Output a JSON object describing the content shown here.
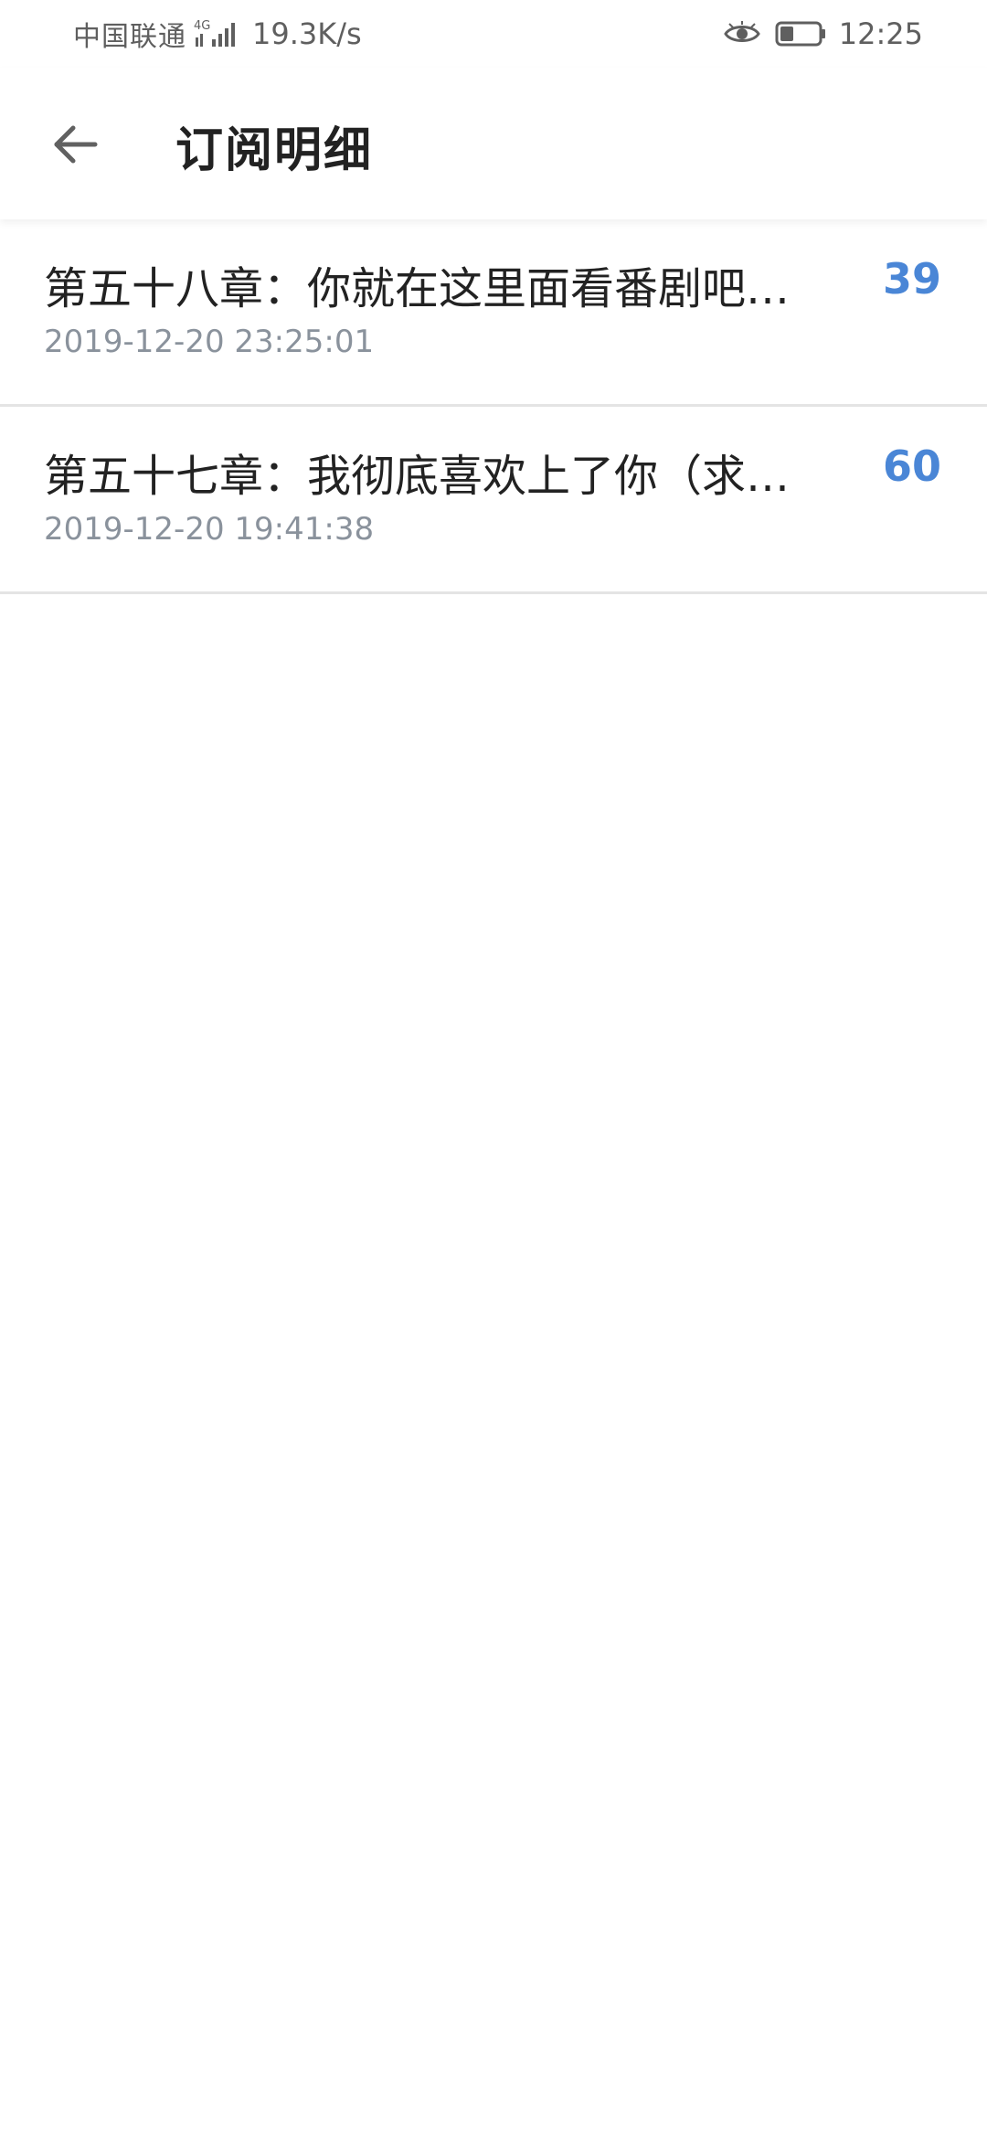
{
  "status_bar": {
    "carrier": "中国联通",
    "network_type": "4G",
    "net_speed": "19.3K/s",
    "time": "12:25",
    "icons": [
      "signal-icon",
      "eye-icon",
      "battery-icon"
    ]
  },
  "app_bar": {
    "back_icon": "arrow-left-icon",
    "title": "订阅明细"
  },
  "subscriptions": [
    {
      "title": "第五十八章：你就在这里面看番剧吧…",
      "time": "2019-12-20 23:25:01",
      "count": "39"
    },
    {
      "title": "第五十七章：我彻底喜欢上了你（求…",
      "time": "2019-12-20 19:41:38",
      "count": "60"
    }
  ],
  "colors": {
    "accent": "#4a86d6",
    "title_text": "#222222",
    "secondary_text": "#8a929c",
    "divider": "#e4e4e4"
  }
}
